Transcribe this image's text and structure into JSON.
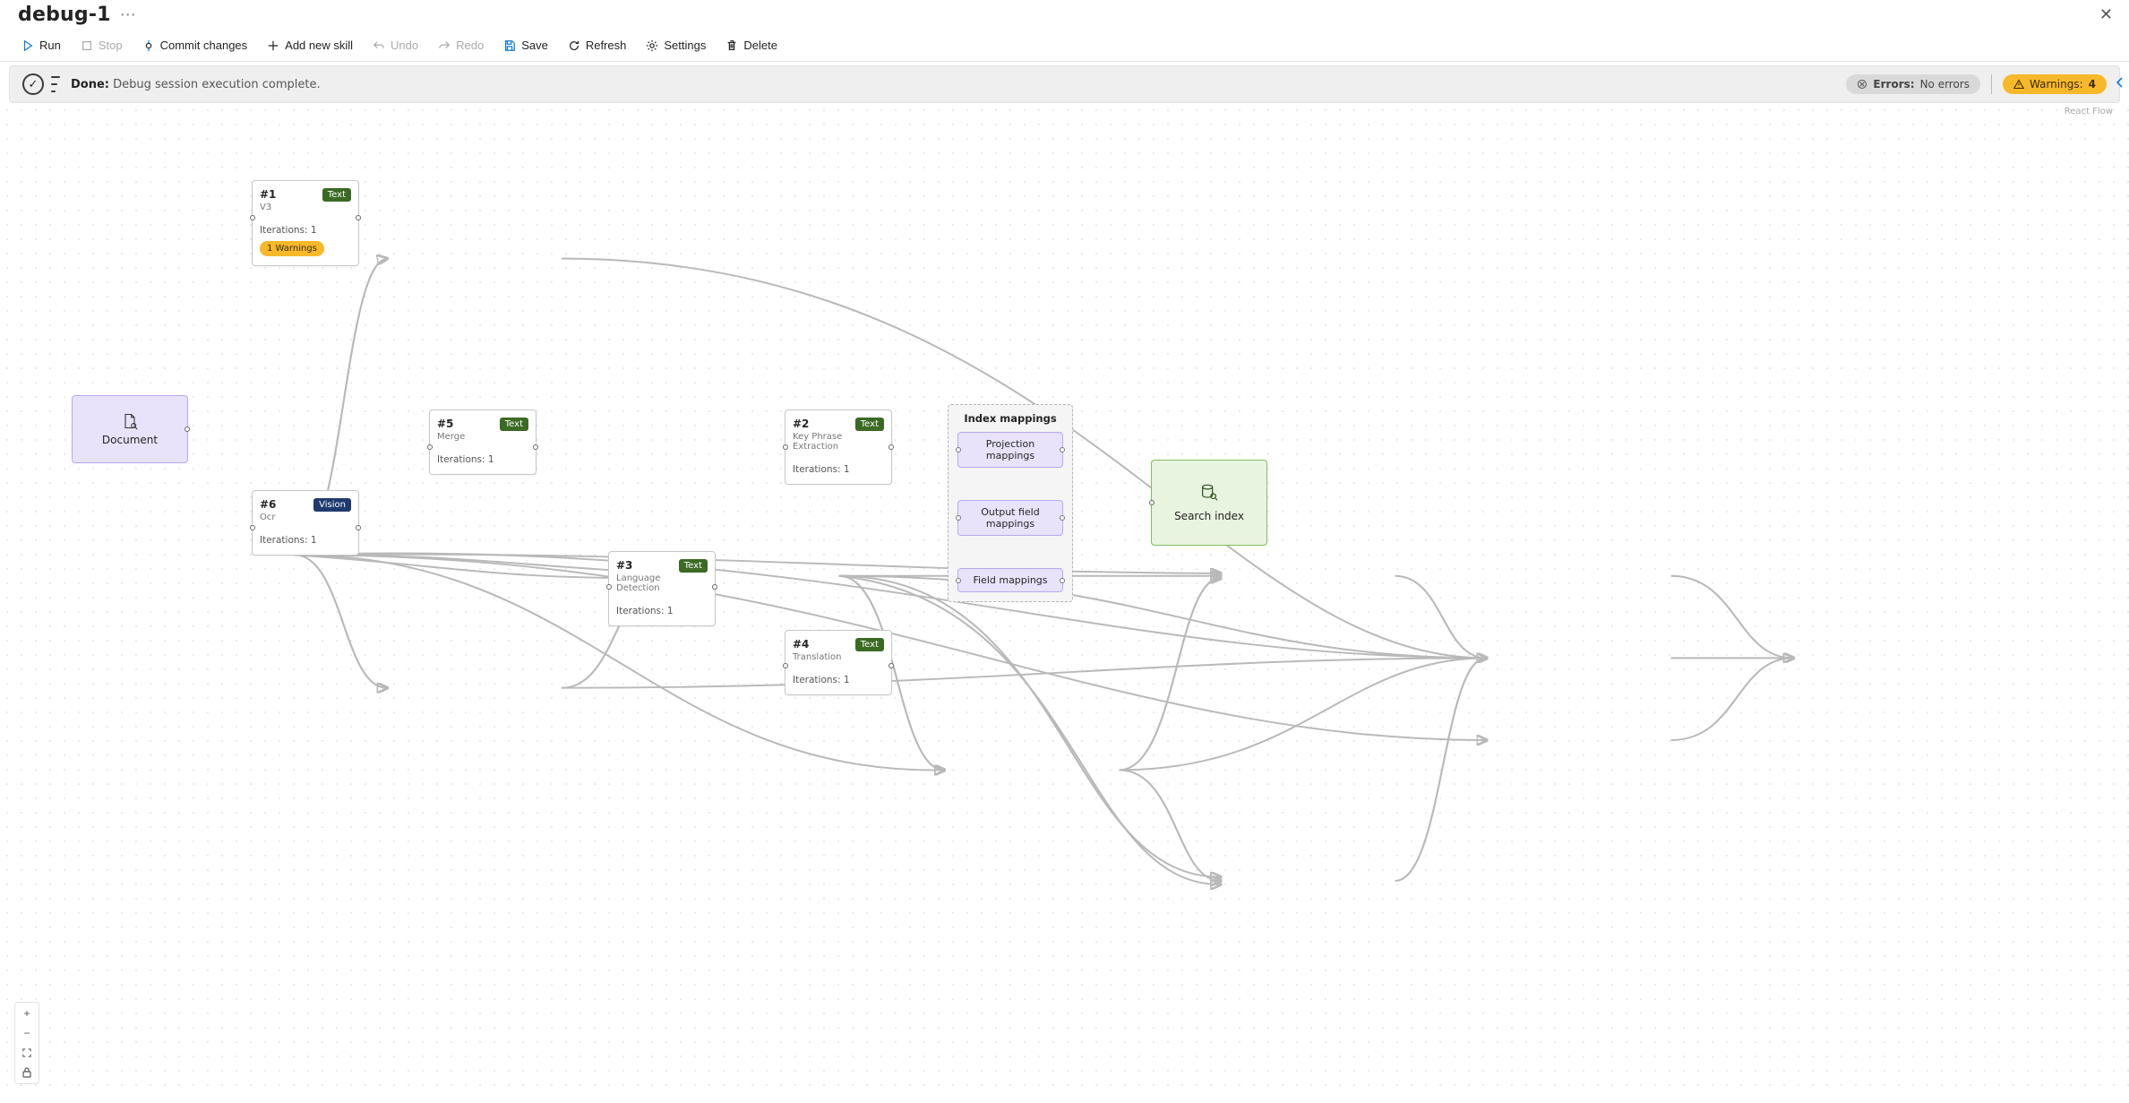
{
  "title": "debug-1",
  "toolbar": {
    "run": "Run",
    "stop": "Stop",
    "commit": "Commit changes",
    "add_skill": "Add new skill",
    "undo": "Undo",
    "redo": "Redo",
    "save": "Save",
    "refresh": "Refresh",
    "settings": "Settings",
    "delete": "Delete"
  },
  "status": {
    "done_label": "Done:",
    "done_text": "Debug session execution complete.",
    "errors_label": "Errors:",
    "errors_value": "No errors",
    "warnings_label": "Warnings:",
    "warnings_value": "4"
  },
  "attribution": "React Flow",
  "nodes": {
    "document": {
      "label": "Document"
    },
    "n1": {
      "num": "#1",
      "sub": "V3",
      "badge": "Text",
      "iter": "Iterations: 1",
      "warn": "1 Warnings"
    },
    "n5": {
      "num": "#5",
      "sub": "Merge",
      "badge": "Text",
      "iter": "Iterations: 1"
    },
    "n6": {
      "num": "#6",
      "sub": "Ocr",
      "badge": "Vision",
      "iter": "Iterations: 1"
    },
    "n2": {
      "num": "#2",
      "sub": "Key Phrase Extraction",
      "badge": "Text",
      "iter": "Iterations: 1"
    },
    "n3": {
      "num": "#3",
      "sub": "Language Detection",
      "badge": "Text",
      "iter": "Iterations: 1"
    },
    "n4": {
      "num": "#4",
      "sub": "Translation",
      "badge": "Text",
      "iter": "Iterations: 1"
    },
    "mappings": {
      "title": "Index mappings",
      "projection": "Projection mappings",
      "output": "Output field mappings",
      "field": "Field mappings"
    },
    "search_index": {
      "label": "Search index"
    }
  }
}
